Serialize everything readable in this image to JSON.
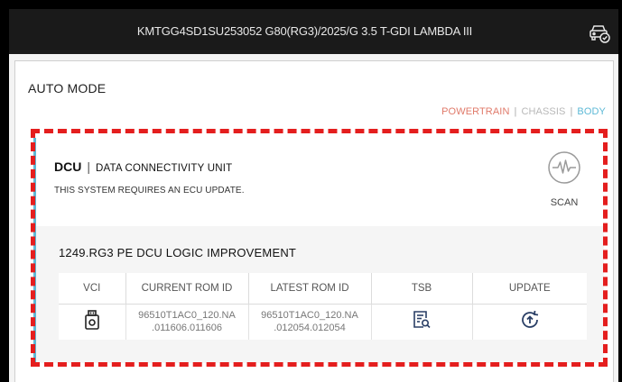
{
  "header": {
    "vehicle_info": "KMTGG4SD1SU253052  G80(RG3)/2025/G 3.5 T-GDI LAMBDA III",
    "vehicle_icon": "car-check-icon"
  },
  "page": {
    "mode_title": "AUTO MODE",
    "categories": [
      {
        "label": "POWERTRAIN",
        "color": "#e07a6a"
      },
      {
        "label": "CHASSIS",
        "color": "#b8b8b8"
      },
      {
        "label": "BODY",
        "color": "#5db9d6"
      }
    ],
    "category_separator": "|"
  },
  "system": {
    "code": "DCU",
    "separator": "|",
    "full_name": "DATA CONNECTIVITY UNIT",
    "message": "THIS SYSTEM REQUIRES AN ECU UPDATE.",
    "scan_label": "SCAN",
    "scan_icon": "waveform-scan-icon"
  },
  "update": {
    "title": "1249.RG3 PE DCU LOGIC IMPROVEMENT",
    "columns": [
      "VCI",
      "CURRENT ROM ID",
      "LATEST ROM ID",
      "TSB",
      "UPDATE"
    ],
    "row": {
      "vci_icon": "usb-device-icon",
      "current_rom_line1": "96510T1AC0_120.NA",
      "current_rom_line2": ".011606.011606",
      "latest_rom_line1": "96510T1AC0_120.NA",
      "latest_rom_line2": ".012054.012054",
      "tsb_icon": "document-search-icon",
      "update_icon": "refresh-upload-icon"
    }
  },
  "colors": {
    "accent": "#5db9d6",
    "highlight": "#e41e1e",
    "header_bg": "#1a1a1a"
  }
}
